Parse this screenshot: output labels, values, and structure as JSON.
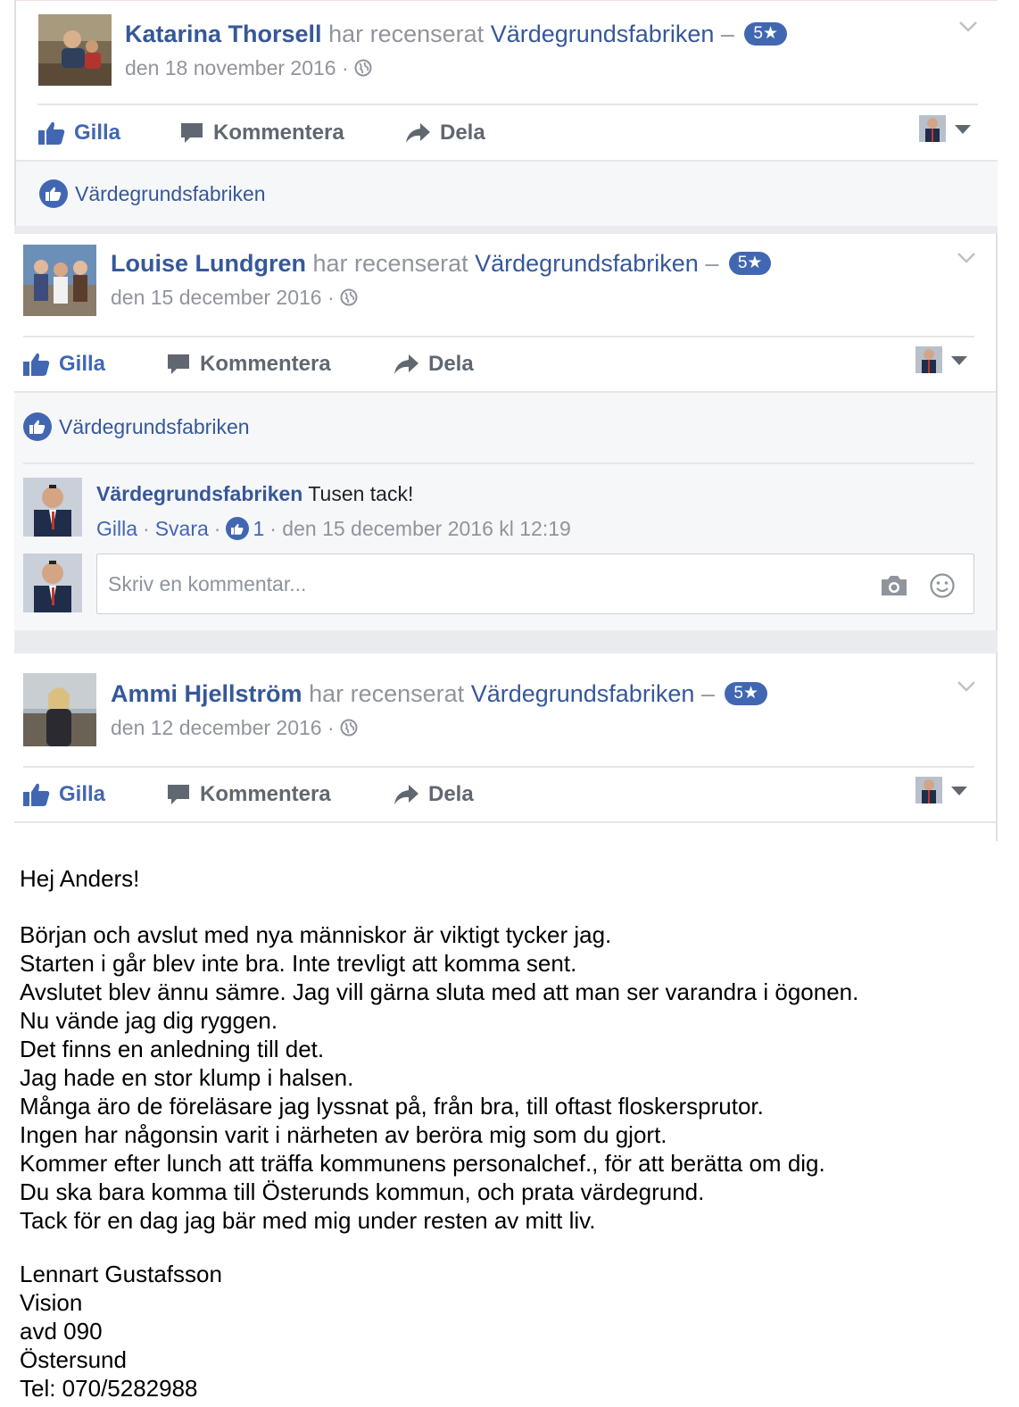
{
  "reviews": [
    {
      "reviewer": "Katarina Thorsell",
      "verb": "har recenserat",
      "page": "Värdegrundsfabriken",
      "dash": "–",
      "rating": "5★",
      "date": "den 18 november 2016 ·"
    },
    {
      "reviewer": "Louise Lundgren",
      "verb": "har recenserat",
      "page": "Värdegrundsfabriken",
      "dash": "–",
      "rating": "5★",
      "date": "den 15 december 2016 ·"
    },
    {
      "reviewer": "Ammi Hjellström",
      "verb": "har recenserat",
      "page": "Värdegrundsfabriken",
      "dash": "–",
      "rating": "5★",
      "date": "den 12 december 2016 ·"
    }
  ],
  "actions": {
    "like": "Gilla",
    "comment": "Kommentera",
    "share": "Dela"
  },
  "likes": {
    "liker": "Värdegrundsfabriken"
  },
  "comment": {
    "author": "Värdegrundsfabriken",
    "text": "Tusen tack!",
    "like": "Gilla",
    "reply": "Svara",
    "sep": "·",
    "like_count": "1",
    "timestamp": "· den 15 december 2016 kl 12:19"
  },
  "composer": {
    "placeholder": "Skriv en kommentar..."
  },
  "letter": {
    "greeting": "Hej Anders!",
    "lines": [
      "Början och avslut med nya människor är viktigt tycker jag.",
      "Starten i går blev inte bra. Inte trevligt att komma sent.",
      "Avslutet blev ännu sämre. Jag vill gärna sluta med att man ser varandra i ögonen.",
      "Nu vände jag dig ryggen.",
      "Det finns en anledning till det.",
      "Jag hade en stor klump i halsen.",
      "Många äro de föreläsare jag lyssnat på, från bra, till oftast floskersprutor.",
      "Ingen har någonsin varit i närheten av beröra mig som du gjort.",
      "Kommer efter lunch att träffa kommunens personalchef., för att berätta om dig.",
      "Du ska bara komma till Österunds kommun, och prata värdegrund.",
      "Tack för en dag jag bär med mig under resten av mitt liv."
    ],
    "signature": [
      "Lennart Gustafsson",
      "Vision",
      "avd 090",
      "Östersund",
      "Tel: 070/5282988"
    ]
  },
  "colors": {
    "link": "#365899",
    "accent": "#4267b2",
    "muted": "#90949c",
    "divider": "#e5e6e9",
    "panel": "#f6f7f9"
  },
  "icons": [
    "globe-icon",
    "chevron-down-icon",
    "thumbs-up-icon",
    "comment-icon",
    "share-arrow-icon",
    "camera-icon",
    "emoji-icon",
    "caret-down-icon"
  ]
}
